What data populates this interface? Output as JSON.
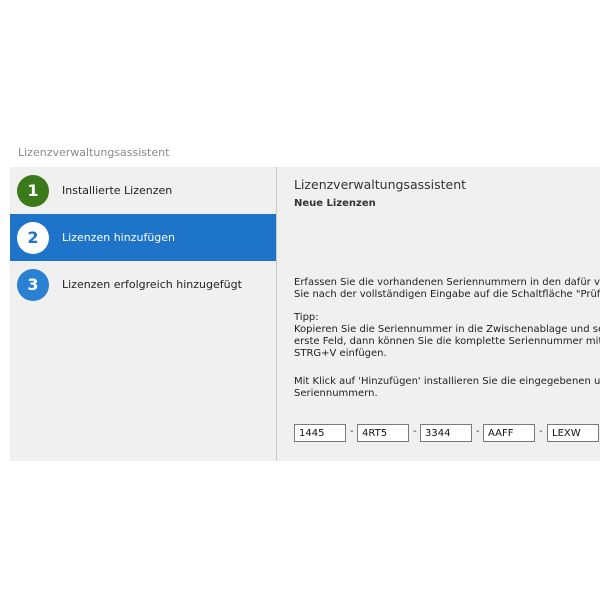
{
  "window": {
    "title": "Lizenzverwaltungsassistent"
  },
  "steps": [
    {
      "number": "1",
      "label": "Installierte Lizenzen",
      "state": "completed"
    },
    {
      "number": "2",
      "label": "Lizenzen hinzufügen",
      "state": "active"
    },
    {
      "number": "3",
      "label": "Lizenzen erfolgreich hinzugefügt",
      "state": "pending"
    }
  ],
  "content": {
    "title": "Lizenzverwaltungsassistent",
    "subtitle": "Neue Lizenzen",
    "instructions": [
      "Erfassen Sie die vorhandenen Seriennummern in den dafür vo",
      "Sie nach der vollständigen Eingabe auf die Schaltfläche \"Prüfe"
    ],
    "tip": [
      "Tipp:",
      "Kopieren Sie die Seriennummer in die Zwischenablage und set",
      "erste Feld, dann können Sie die komplette Seriennummer mit d",
      "STRG+V einfügen."
    ],
    "install_note": [
      "Mit Klick auf 'Hinzufügen' installieren Sie die eingegebenen und",
      "Seriennummern."
    ]
  },
  "serial": {
    "separator": "-",
    "fields": [
      "1445",
      "4RT5",
      "3344",
      "AAFF",
      "LEXW"
    ]
  },
  "colors": {
    "accent": "#1e74c8",
    "completed": "#3a7a1a",
    "pending": "#2a80d2",
    "panel_bg": "#f0f0f0"
  }
}
